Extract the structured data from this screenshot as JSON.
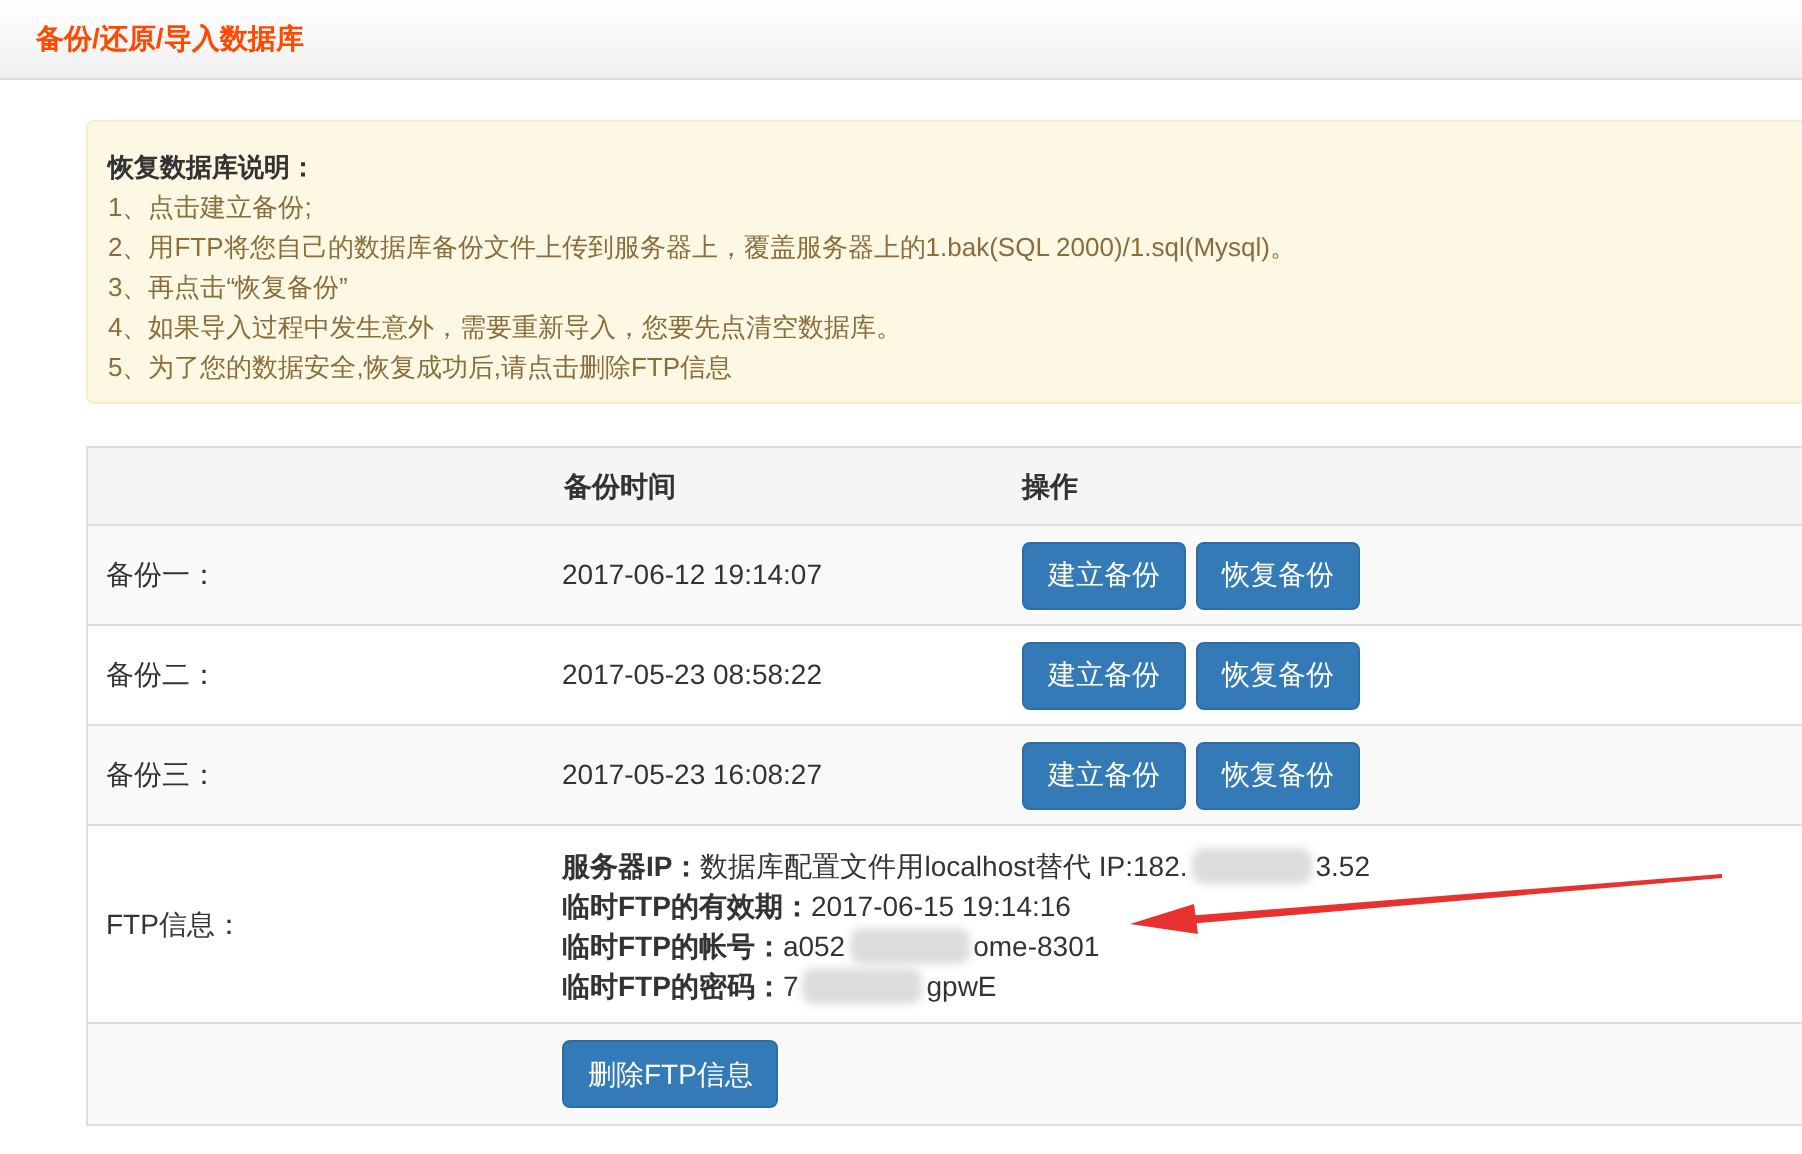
{
  "page_title": "备份/还原/导入数据库",
  "notice": {
    "heading": "恢复数据库说明：",
    "lines": [
      "1、点击建立备份;",
      "2、用FTP将您自己的数据库备份文件上传到服务器上，覆盖服务器上的1.bak(SQL 2000)/1.sql(Mysql)。",
      "3、再点击“恢复备份”",
      "4、如果导入过程中发生意外，需要重新导入，您要先点清空数据库。",
      "5、为了您的数据安全,恢复成功后,请点击删除FTP信息"
    ]
  },
  "table": {
    "columns": [
      "备份时间",
      "操作"
    ],
    "rows": [
      {
        "label": "备份一：",
        "time": "2017-06-12 19:14:07",
        "actions": [
          "建立备份",
          "恢复备份"
        ]
      },
      {
        "label": "备份二：",
        "time": "2017-05-23 08:58:22",
        "actions": [
          "建立备份",
          "恢复备份"
        ]
      },
      {
        "label": "备份三：",
        "time": "2017-05-23 16:08:27",
        "actions": [
          "建立备份",
          "恢复备份"
        ]
      }
    ],
    "ftp": {
      "label": "FTP信息：",
      "fields": [
        {
          "name": "服务器IP：",
          "value_start": "数据库配置文件用localhost替代 IP:182.",
          "value_end": "3.52"
        },
        {
          "name": "临时FTP的有效期：",
          "value_start": "2017-06-15 19:14:16"
        },
        {
          "name": "临时FTP的帐号：",
          "value_start": "a052",
          "value_end": "ome-8301"
        },
        {
          "name": "临时FTP的密码：",
          "value_start": "7",
          "value_end": "gpwE"
        }
      ]
    },
    "delete_button": "删除FTP信息"
  }
}
